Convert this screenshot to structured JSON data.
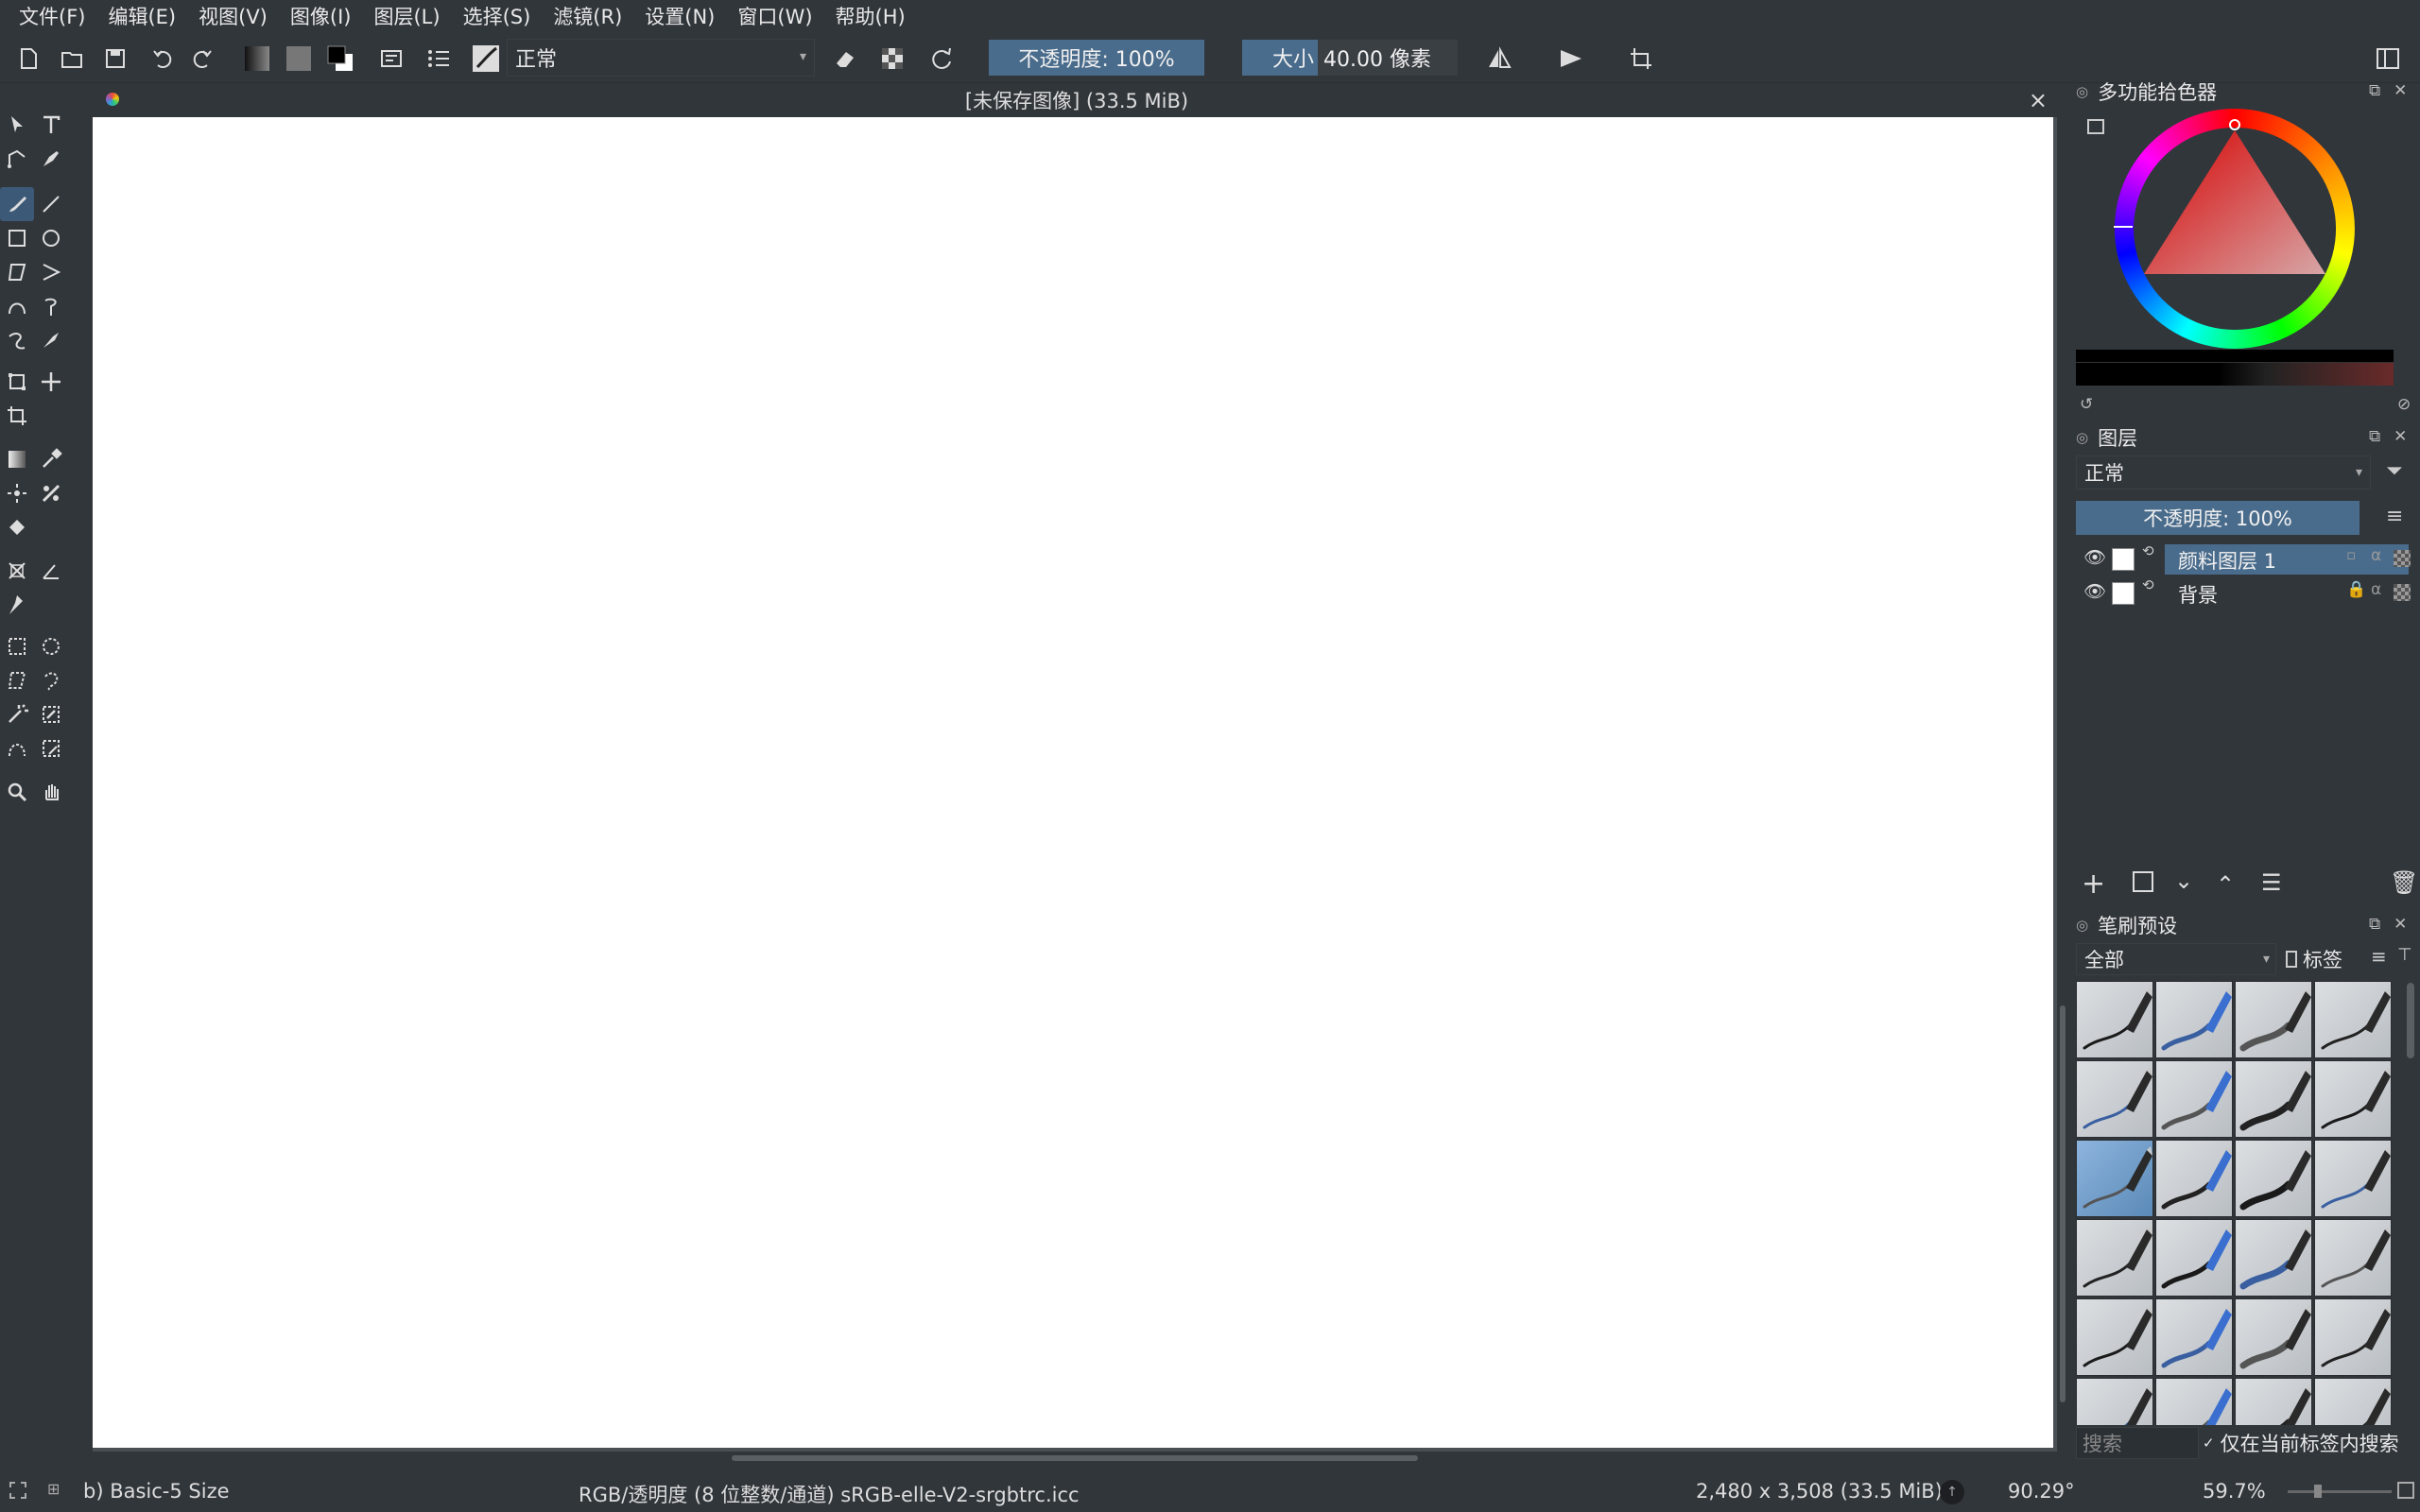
{
  "menu": [
    "文件(F)",
    "编辑(E)",
    "视图(V)",
    "图像(I)",
    "图层(L)",
    "选择(S)",
    "滤镜(R)",
    "设置(N)",
    "窗口(W)",
    "帮助(H)"
  ],
  "toolbar": {
    "blend_mode": "正常",
    "opacity": "不透明度: 100%",
    "size_label": "大小",
    "size_value": "40.00 像素"
  },
  "document": {
    "title": "[未保存图像]  (33.5 MiB)",
    "close": "×"
  },
  "color_picker": {
    "title": "多功能拾色器",
    "accent": "#ff0000"
  },
  "layers": {
    "title": "图层",
    "blend_mode": "正常",
    "opacity": "不透明度:  100%",
    "items": [
      {
        "name": "颜料图层 1",
        "selected": true
      },
      {
        "name": "背景",
        "selected": false
      }
    ]
  },
  "brushes": {
    "title": "笔刷预设",
    "filter": "全部",
    "tag_label": "标签",
    "search_placeholder": "搜索",
    "search_in_tag": "仅在当前标签内搜索"
  },
  "status": {
    "brush": "b) Basic-5 Size",
    "color_model": "RGB/透明度 (8 位整数/通道)  sRGB-elle-V2-srgbtrc.icc",
    "dimensions": "2,480 x 3,508 (33.5 MiB)",
    "rotation": "90.29°",
    "zoom": "59.7%"
  },
  "colors": {
    "accent": "#4a6c8c",
    "bg": "#31363b"
  }
}
